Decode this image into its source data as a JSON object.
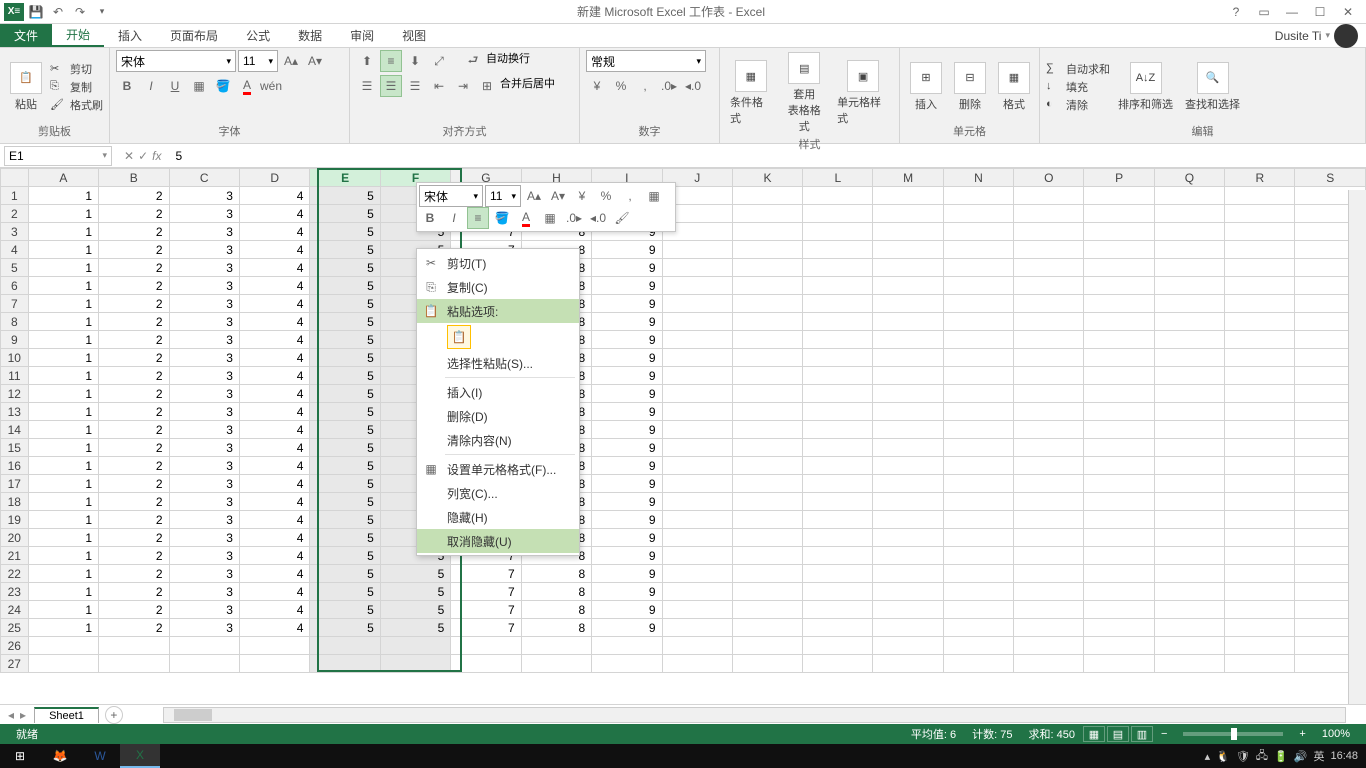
{
  "title": "新建 Microsoft Excel 工作表 - Excel",
  "account_name": "Dusite Ti",
  "tabs": {
    "file": "文件",
    "home": "开始",
    "insert": "插入",
    "layout": "页面布局",
    "formulas": "公式",
    "data": "数据",
    "review": "审阅",
    "view": "视图"
  },
  "ribbon": {
    "clipboard": {
      "label": "剪贴板",
      "paste": "粘贴",
      "cut": "剪切",
      "copy": "复制",
      "format_painter": "格式刷"
    },
    "font": {
      "label": "字体",
      "name": "宋体",
      "size": "11"
    },
    "align": {
      "label": "对齐方式",
      "wrap": "自动换行",
      "merge": "合并后居中"
    },
    "number": {
      "label": "数字",
      "format": "常规"
    },
    "styles": {
      "label": "样式",
      "conditional": "条件格式",
      "table": "套用\n表格格式",
      "cell": "单元格样式"
    },
    "cells": {
      "label": "单元格",
      "insert": "插入",
      "delete": "删除",
      "format": "格式"
    },
    "editing": {
      "label": "编辑",
      "sum": "自动求和",
      "fill": "填充",
      "clear": "清除",
      "sort": "排序和筛选",
      "find": "查找和选择"
    }
  },
  "name_box": "E1",
  "formula": "5",
  "columns": [
    "A",
    "B",
    "C",
    "D",
    "E",
    "F",
    "G",
    "H",
    "I",
    "J",
    "K",
    "L",
    "M",
    "N",
    "O",
    "P",
    "Q",
    "R",
    "S"
  ],
  "row_count": 27,
  "data_row": [
    "1",
    "2",
    "3",
    "4",
    "5",
    "5",
    "7",
    "8",
    "9"
  ],
  "hidden_range_rows": [
    1,
    25
  ],
  "selected_col_index": 4,
  "selected_col_span": 2,
  "mini": {
    "font": "宋体",
    "size": "11"
  },
  "ctx": {
    "cut": "剪切(T)",
    "copy": "复制(C)",
    "paste_opts": "粘贴选项:",
    "paste_special": "选择性粘贴(S)...",
    "insert": "插入(I)",
    "delete": "删除(D)",
    "clear": "清除内容(N)",
    "format_cells": "设置单元格格式(F)...",
    "col_width": "列宽(C)...",
    "hide": "隐藏(H)",
    "unhide": "取消隐藏(U)"
  },
  "sheet_tab": "Sheet1",
  "status": {
    "ready": "就绪",
    "avg_label": "平均值:",
    "avg": "6",
    "count_label": "计数:",
    "count": "75",
    "sum_label": "求和:",
    "sum": "450",
    "zoom": "100%"
  },
  "taskbar": {
    "ime": "英",
    "time": "16:48"
  }
}
